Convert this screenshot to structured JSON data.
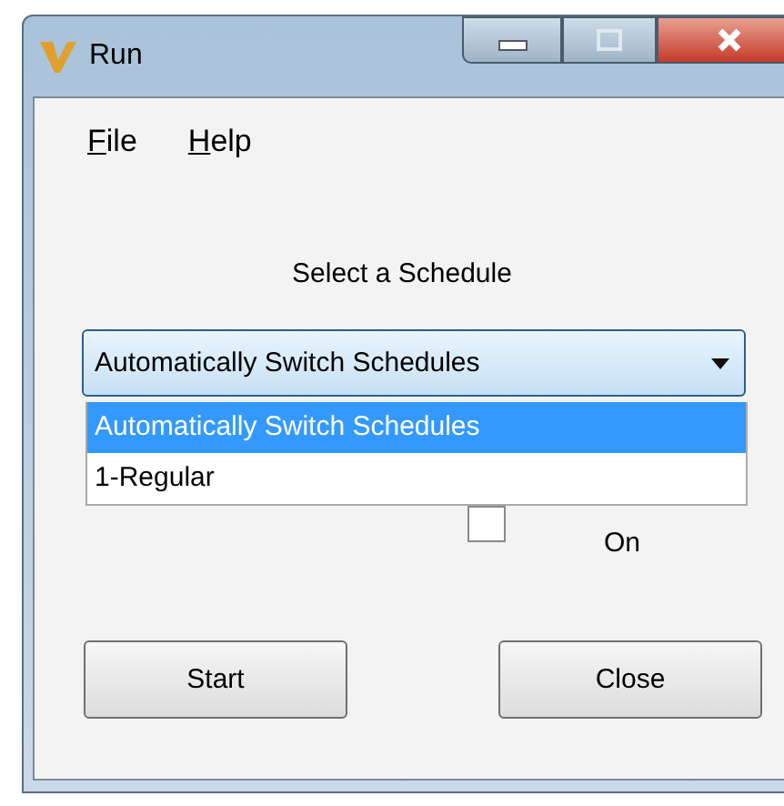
{
  "window": {
    "title": "Run"
  },
  "menu": [
    {
      "label": "File"
    },
    {
      "label": "Help"
    }
  ],
  "prompt": "Select a Schedule",
  "schedule": {
    "value": "Automatically Switch Schedules",
    "expanded": true,
    "options": [
      {
        "label": "Automatically Switch Schedules",
        "selected": true
      },
      {
        "label": "1-Regular",
        "selected": false
      }
    ]
  },
  "checkbox": {
    "label": "On",
    "checked": false
  },
  "buttons": [
    {
      "label": "Start"
    },
    {
      "label": "Close"
    }
  ]
}
